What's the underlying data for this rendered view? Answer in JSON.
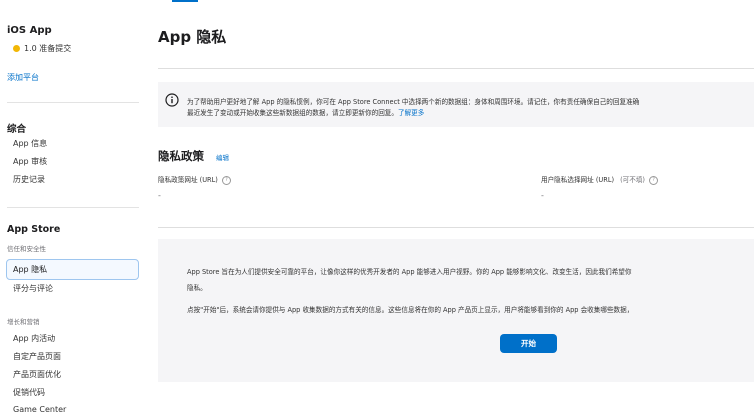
{
  "sidebar": {
    "app_name": "iOS App",
    "version_status": "1.0 准备提交",
    "add_platform": "添加平台",
    "general": {
      "title": "综合",
      "items": [
        {
          "label": "App 信息"
        },
        {
          "label": "App 审核"
        },
        {
          "label": "历史记录"
        }
      ]
    },
    "app_store": {
      "title": "App Store",
      "trust_subtitle": "信任和安全性",
      "trust_items": [
        {
          "label": "App 隐私"
        },
        {
          "label": "评分与评论"
        }
      ],
      "growth_subtitle": "增长和营销",
      "growth_items": [
        {
          "label": "App 内活动"
        },
        {
          "label": "自定产品页面"
        },
        {
          "label": "产品页面优化"
        },
        {
          "label": "促销代码"
        },
        {
          "label": "Game Center"
        }
      ]
    }
  },
  "main": {
    "title": "App 隐私",
    "notice": {
      "line1": "为了帮助用户更好地了解 App 的隐私惯例，你可在 App Store Connect 中选择两个新的数据组：身体和周围环境。请记住，你有责任确保自己的回复准确",
      "line2": "最近发生了变动或开始收集这些新数据组的数据，请立即更新你的回复。",
      "link": "了解更多"
    },
    "policy": {
      "title": "隐私政策",
      "edit": "编辑",
      "url_label": "隐私政策网址 (URL)",
      "url_value": "-",
      "choice_label": "用户隐私选择网址 (URL)",
      "choice_optional": "(可不填)",
      "choice_value": "-"
    },
    "start": {
      "text1": "App Store 旨在为人们提供安全可靠的平台，让像你这样的优秀开发者的 App 能够进入用户视野。你的 App 能够影响文化、改变生活，因此我们希望你",
      "text2": "隐私。",
      "text3": "点按\"开始\"后，系统会请你提供与 App 收集数据的方式有关的信息。这些信息将在你的 App 产品页上显示，用户将能够看到你的 App 会收集哪些数据，",
      "button": "开始"
    }
  },
  "colors": {
    "accent": "#0070c9",
    "status_dot": "#f2b705",
    "panel_bg": "#f5f5f7"
  }
}
